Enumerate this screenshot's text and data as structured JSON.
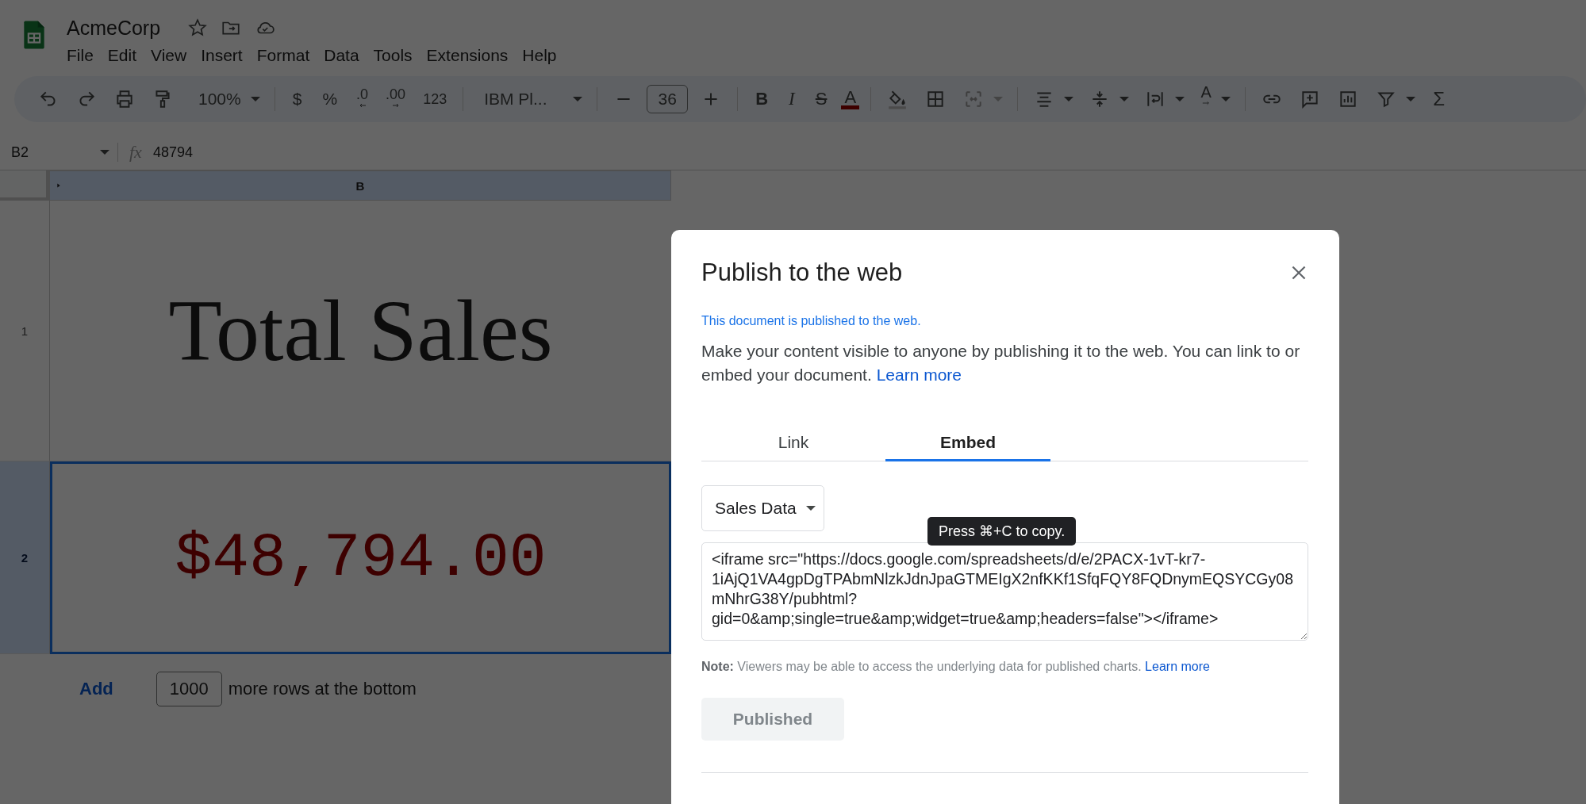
{
  "app": {
    "doc_title": "AcmeCorp",
    "menu": [
      "File",
      "Edit",
      "View",
      "Insert",
      "Format",
      "Data",
      "Tools",
      "Extensions",
      "Help"
    ]
  },
  "toolbar": {
    "zoom": "100%",
    "currency": "$",
    "percent": "%",
    "decrease_decimal": ".0",
    "increase_decimal": ".00",
    "number_format": "123",
    "font": "IBM Pl...",
    "font_size": "36",
    "bold": "B",
    "italic": "I",
    "strikethrough": "S",
    "text_color": "A",
    "text_rotation": "A",
    "functions": "Σ"
  },
  "formula_bar": {
    "cell_ref": "B2",
    "function_symbol": "fx",
    "formula": "48794"
  },
  "sheet": {
    "columns": [
      {
        "label": "B",
        "selected": true
      }
    ],
    "rows": [
      {
        "number": "1",
        "selected": false,
        "kind": "title",
        "value": "Total Sales"
      },
      {
        "number": "2",
        "selected": true,
        "kind": "currency",
        "value": "$48,794.00"
      }
    ],
    "add_rows": {
      "button": "Add",
      "count": "1000",
      "suffix": "more rows at the bottom"
    }
  },
  "dialog": {
    "title": "Publish to the web",
    "status": "This document is published to the web.",
    "description": "Make your content visible to anyone by publishing it to the web. You can link to or embed your document.",
    "description_link": "Learn more",
    "tabs": [
      {
        "label": "Link",
        "selected": false
      },
      {
        "label": "Embed",
        "selected": true
      }
    ],
    "sheet_select": "Sales Data",
    "tooltip": "Press ⌘+C to copy.",
    "embed_code": "<iframe src=\"https://docs.google.com/spreadsheets/d/e/2PACX-1vT-kr7-1iAjQ1VA4gpDgTPAbmNlzkJdnJpaGTMEIgX2nfKKf1SfqFQY8FQDnymEQSYCGy08mNhrG38Y/pubhtml?gid=0&amp;single=true&amp;widget=true&amp;headers=false\"></iframe>",
    "note": "**Note:** Viewers may be able to access the underlying data for published charts.",
    "note_link": "Learn more",
    "publish_button": {
      "label": "Published",
      "disabled": true
    }
  }
}
